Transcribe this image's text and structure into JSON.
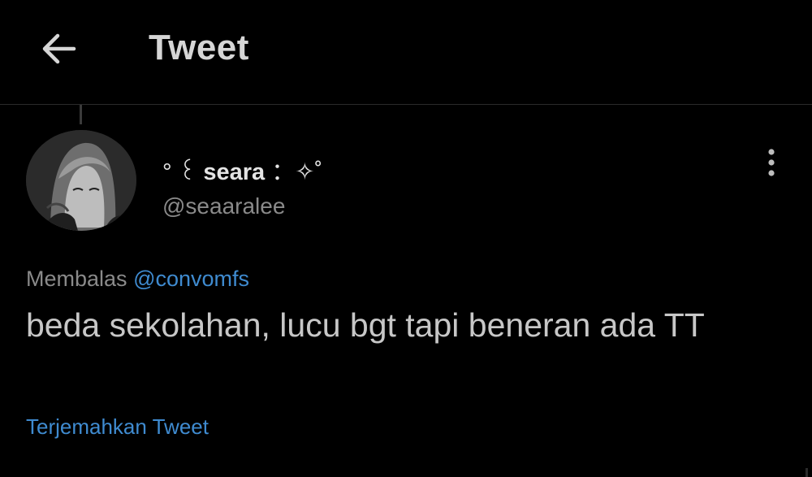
{
  "header": {
    "title": "Tweet",
    "back_icon": "arrow-left-icon"
  },
  "tweet": {
    "author": {
      "name_prefix": "° ꒰",
      "name": "seara",
      "name_suffix": " ：✧˚",
      "handle": "@seaaralee",
      "avatar_icon": "avatar-image"
    },
    "reply_prefix": "Membalas",
    "reply_to": "@convomfs",
    "text": "beda sekolahan, lucu bgt tapi beneran ada TT",
    "translate_label": "Terjemahkan Tweet",
    "more_icon": "more-vertical-icon"
  },
  "colors": {
    "background": "#000000",
    "link": "#3f8bd0",
    "text": "#c7c7c7",
    "muted": "#8a8a8a"
  }
}
